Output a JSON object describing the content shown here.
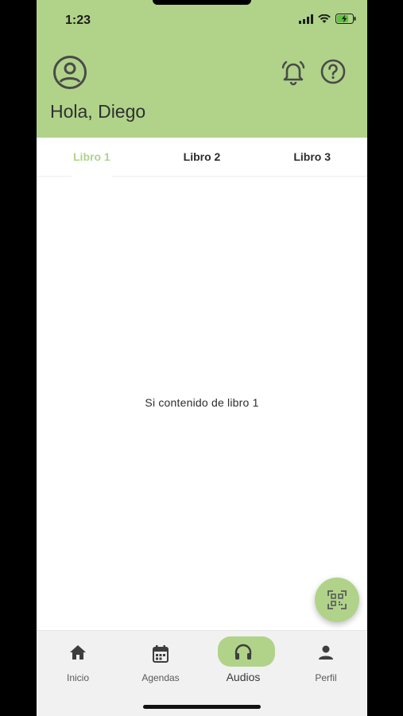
{
  "status_bar": {
    "time": "1:23"
  },
  "header": {
    "greeting": "Hola, Diego",
    "bg_color": "#b0d389",
    "icons": [
      "account-circle-icon",
      "bell-icon",
      "help-icon"
    ]
  },
  "tabs": [
    {
      "label": "Libro 1",
      "active": true
    },
    {
      "label": "Libro 2",
      "active": false
    },
    {
      "label": "Libro 3",
      "active": false
    }
  ],
  "main": {
    "content_text": "Si contenido de libro 1"
  },
  "fab": {
    "icon": "qr-scan-icon"
  },
  "bottom_nav": [
    {
      "label": "Inicio",
      "icon": "home-icon",
      "active": false
    },
    {
      "label": "Agendas",
      "icon": "calendar-icon",
      "active": false
    },
    {
      "label": "Audios",
      "icon": "headphones-icon",
      "active": true
    },
    {
      "label": "Perfil",
      "icon": "person-icon",
      "active": false
    }
  ],
  "colors": {
    "accent": "#b0d389",
    "text": "#2c2c2c",
    "nav_bg": "#f1f1f1"
  }
}
